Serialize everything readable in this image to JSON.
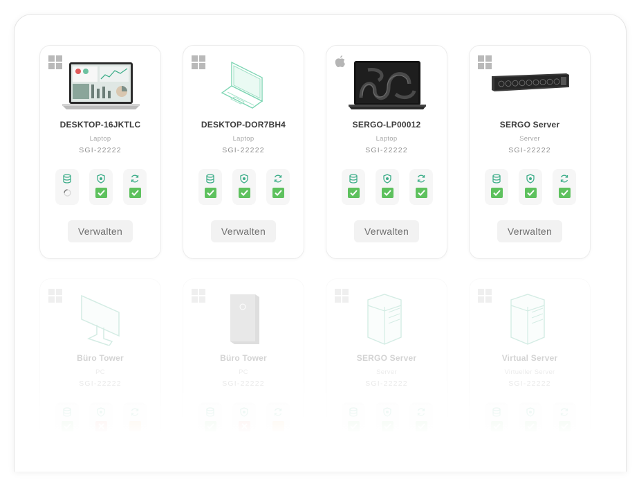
{
  "devices": [
    {
      "name": "DESKTOP-16JKTLC",
      "type": "Laptop",
      "id": "SGI-22222",
      "os": "windows",
      "image": "laptop-photo",
      "status": [
        "loading",
        "ok",
        "ok"
      ],
      "button": "Verwalten"
    },
    {
      "name": "DESKTOP-DOR7BH4",
      "type": "Laptop",
      "id": "SGI-22222",
      "os": "windows",
      "image": "laptop-outline",
      "status": [
        "ok",
        "ok",
        "ok"
      ],
      "button": "Verwalten"
    },
    {
      "name": "SERGO-LP00012",
      "type": "Laptop",
      "id": "SGI-22222",
      "os": "apple",
      "image": "macbook-photo",
      "status": [
        "ok",
        "ok",
        "ok"
      ],
      "button": "Verwalten"
    },
    {
      "name": "SERGO Server",
      "type": "Server",
      "id": "SGI-22222",
      "os": "windows",
      "image": "rack-server-photo",
      "status": [
        "ok",
        "ok",
        "ok"
      ],
      "button": "Verwalten"
    },
    {
      "name": "Büro Tower",
      "type": "PC",
      "id": "SGI-22222",
      "os": "windows",
      "image": "monitor-outline",
      "status": [
        "ok",
        "error",
        "warning"
      ]
    },
    {
      "name": "Büro Tower",
      "type": "PC",
      "id": "SGI-22222",
      "os": "windows",
      "image": "tower-photo",
      "status": [
        "ok",
        "error",
        "warning"
      ]
    },
    {
      "name": "SERGO Server",
      "type": "Server",
      "id": "SGI-22222",
      "os": "windows",
      "image": "server-stack-outline",
      "status": [
        "ok",
        "ok",
        "ok"
      ]
    },
    {
      "name": "Virtual Server",
      "type": "Virtueller Server",
      "id": "SGI-22222",
      "os": "windows",
      "image": "server-stack-outline",
      "status": [
        "ok",
        "ok",
        "ok"
      ]
    }
  ],
  "status_icons": [
    "database-icon",
    "shield-icon",
    "sync-icon"
  ],
  "colors": {
    "accent": "#3fae8a",
    "ok": "#5ec15e",
    "error": "#e0594f",
    "warning": "#f2a23c"
  }
}
